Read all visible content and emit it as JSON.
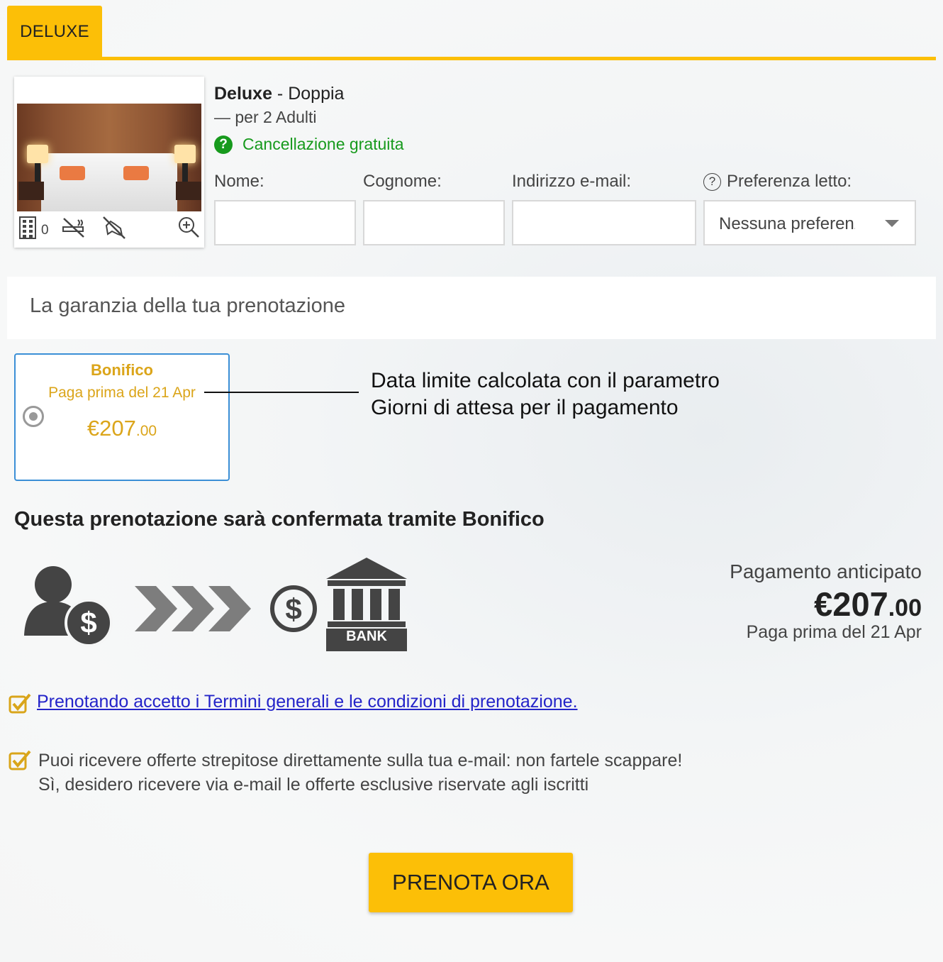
{
  "tab": {
    "label": "DELUXE"
  },
  "room": {
    "name": "Deluxe",
    "type": " - Doppia",
    "occupancy": "— per 2 Adulti",
    "cancellation": "Cancellazione gratuita",
    "available_count": "0",
    "icons": [
      "building-icon",
      "no-smoking-icon",
      "no-pets-icon",
      "zoom-icon"
    ]
  },
  "form": {
    "first_name_label": "Nome:",
    "last_name_label": "Cognome:",
    "email_label": "Indirizzo e-mail:",
    "bed_pref_label": "Preferenza letto:",
    "bed_pref_value": "Nessuna preferenza"
  },
  "guarantee": {
    "heading": "La garanzia della tua prenotazione",
    "method_name": "Bonifico",
    "pay_before": "Paga prima del 21 Apr",
    "price_main": "€207",
    "price_cents": ".00"
  },
  "annotation": {
    "line1": "Data limite calcolata con il parametro",
    "line2": "Giorni di attesa per il pagamento"
  },
  "confirmation": {
    "text": "Questa prenotazione sarà confermata tramite Bonifico"
  },
  "diagram": {
    "bank_label": "BANK"
  },
  "prepayment": {
    "label": "Pagamento anticipato",
    "amount_main": "€207",
    "amount_cents": ".00",
    "pay_before": "Paga prima del 21 Apr"
  },
  "consents": {
    "terms": "Prenotando accetto i Termini generali e le condizioni di prenotazione.",
    "offers_line1": "Puoi ricevere offerte strepitose direttamente sulla tua e-mail: non fartele scappare!",
    "offers_line2": "Sì, desidero ricevere via e-mail le offerte esclusive riservate agli iscritti"
  },
  "cta": {
    "label": "PRENOTA ORA"
  },
  "colors": {
    "accent": "#fcbf07",
    "success": "#179a1d",
    "price": "#dba51a",
    "link": "#2424c9",
    "selected_border": "#3b8fd6"
  }
}
